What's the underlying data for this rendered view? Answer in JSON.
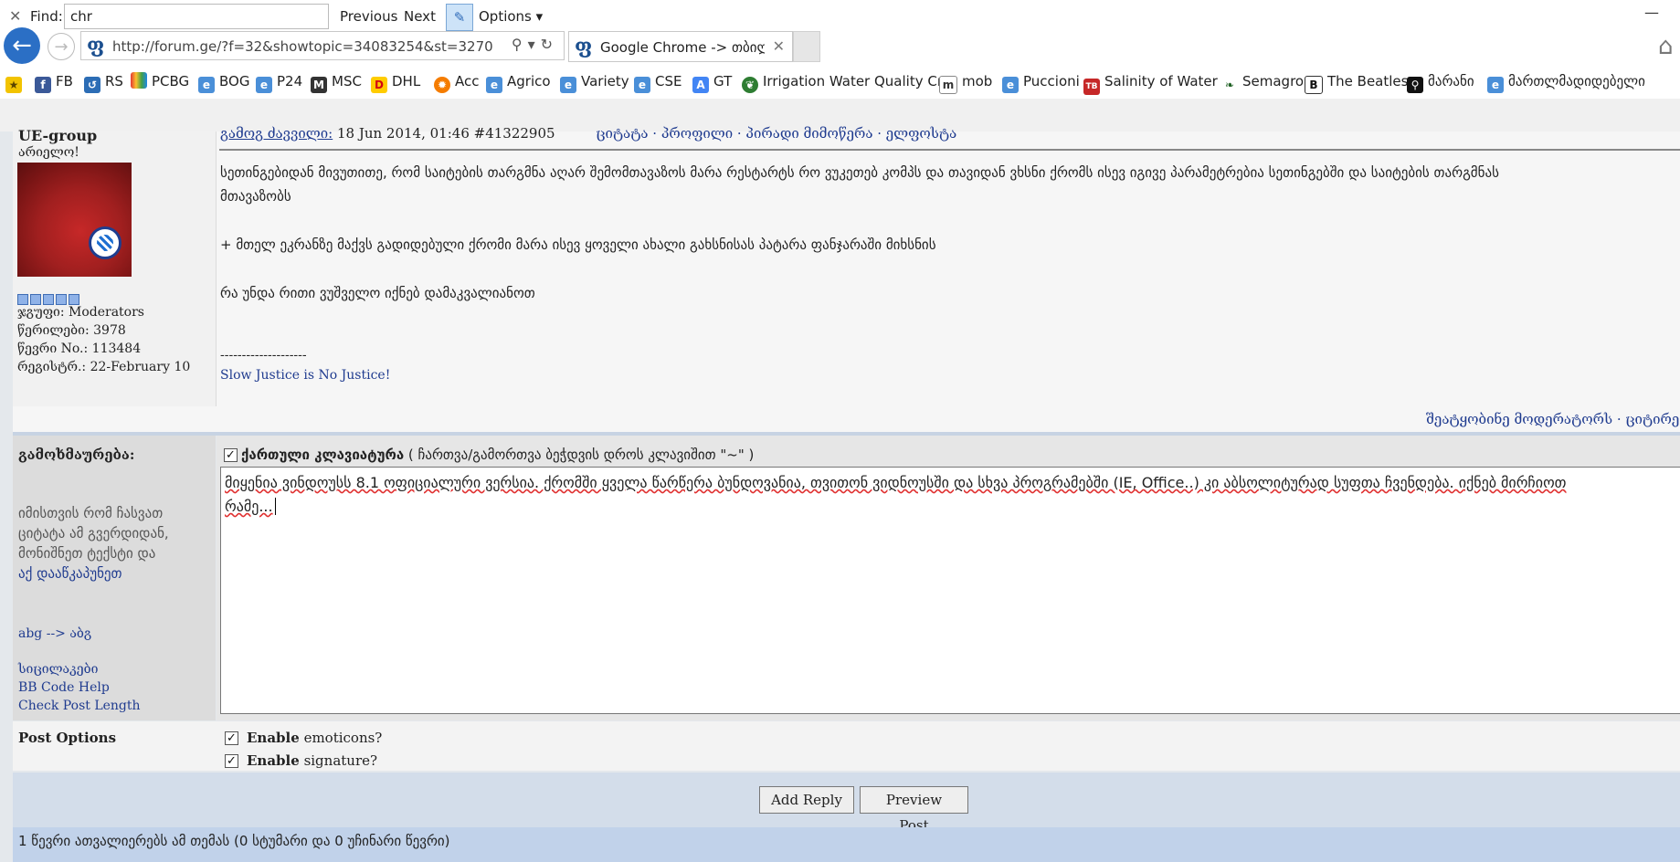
{
  "browser": {
    "address_url": "http://forum.ge/?f=32&showtopic=34083254&st=3270",
    "tab_title": "Google Chrome -> თბილ...",
    "favorites": [
      {
        "label": "",
        "icon": "star-icon"
      },
      {
        "label": "FB",
        "icon": "facebook-icon"
      },
      {
        "label": "RS",
        "icon": "rs-icon"
      },
      {
        "label": "PCBG",
        "icon": "pcbg-icon"
      },
      {
        "label": "BOG",
        "icon": "ie-page-icon"
      },
      {
        "label": "P24",
        "icon": "ie-page-icon"
      },
      {
        "label": "MSC",
        "icon": "msc-icon"
      },
      {
        "label": "DHL",
        "icon": "dhl-icon"
      },
      {
        "label": "Acc",
        "icon": "acc-icon"
      },
      {
        "label": "Agrico",
        "icon": "ie-page-icon"
      },
      {
        "label": "Variety",
        "icon": "ie-page-icon"
      },
      {
        "label": "CSE",
        "icon": "ie-page-icon"
      },
      {
        "label": "GT",
        "icon": "translate-icon"
      },
      {
        "label": "Irrigation Water Quality Cr...",
        "icon": "leaf-badge-icon"
      },
      {
        "label": "mob",
        "icon": "mob-icon"
      },
      {
        "label": "Puccioni",
        "icon": "ie-page-icon"
      },
      {
        "label": "Salinity of Water",
        "icon": "toolbox-icon"
      },
      {
        "label": "Semagro",
        "icon": "leaf-icon"
      },
      {
        "label": "The Beatles",
        "icon": "b-icon"
      },
      {
        "label": "მარანი",
        "icon": "figure-icon"
      },
      {
        "label": "მართლმადიდებელი",
        "icon": "ie-page-icon"
      }
    ],
    "find": {
      "close": "✕",
      "label": "Find:",
      "value": "chr",
      "previous": "Previous",
      "next": "Next",
      "options": "Options"
    }
  },
  "post": {
    "author": "UE-group",
    "status": "არიელო!",
    "group": "ჯგუფი: Moderators",
    "posts": "წერილები: 3978",
    "member_no": "წევრი No.: 113484",
    "registered": "რეგისტრ.: 22-February 10",
    "header_link": "გამოგ ძავვილი:",
    "header_date": " 18 Jun 2014, 01:46  #41322905",
    "header_actions": "ციტატა · პროფილი · პირადი მიმოწერა · ელფოსტა",
    "lines": [
      "სეთინგებიდან მივუთითე, რომ საიტების თარგმნა აღარ შემომთავაზოს მარა რესტარტს რო ვუკეთებ კომპს და თავიდან ვხსნი ქრომს ისევ იგივე პარამეტრებია სეთინგებში და საიტების თარგმნას",
      "მთავაზობს",
      "+ მთელ ეკრანზე მაქვს გადიდებული ქრომი მარა ისევ ყოველი ახალი გახსნისას პატარა ფანჯარაში მიხსნის",
      "რა უნდა რითი ვუშველო იქნებ დამაკვალიანოთ"
    ],
    "sig_separator": "--------------------",
    "signature": "Slow Justice is No Justice!",
    "footer_actions": "შეატყობინე მოდერატორს  · ციტირე"
  },
  "reply": {
    "label": "გამოხმაურება:",
    "help": [
      "იმისთვის რომ ჩასვათ",
      "ციტატა ამ გვერდიდან,",
      "მონიშნეთ ტექსტი და"
    ],
    "help_link": "აქ დააწკაპუნეთ",
    "translit": "abg --> აბგ",
    "links": [
      "სიცილაკები",
      "BB Code Help",
      "Check Post Length"
    ],
    "keyboard_label": "ქართული კლავიატურა",
    "keyboard_hint": " ( ჩართვა/გამორთვა ბეჭდვის დროს კლავიშით \"~\" )",
    "text_line1": "მიყენია ვინდოუსს 8.1 ოფიციალური ვერსია. ქრომში ყველა წარწერა ბუნდოვანია, თვითონ ვიდნოუსში და სხვა პროგრამებში (IE, Office..) კი აბსოლიტურად სუფთა ჩვენდება. იქნებ მირჩიოთ",
    "text_line2": "რამე...",
    "options_label": "Post Options",
    "opt1_bold": "Enable",
    "opt1_rest": " emoticons?",
    "opt2_bold": "Enable",
    "opt2_rest": " signature?",
    "add_reply": "Add Reply",
    "preview": "Preview Post",
    "viewers": "1 წევრი ათვალიერებს ამ თემას (0 სტუმარი და 0 უჩინარი წევრი)"
  },
  "colors": {
    "link": "#1f3b8f",
    "accent": "#2b6fc5"
  }
}
